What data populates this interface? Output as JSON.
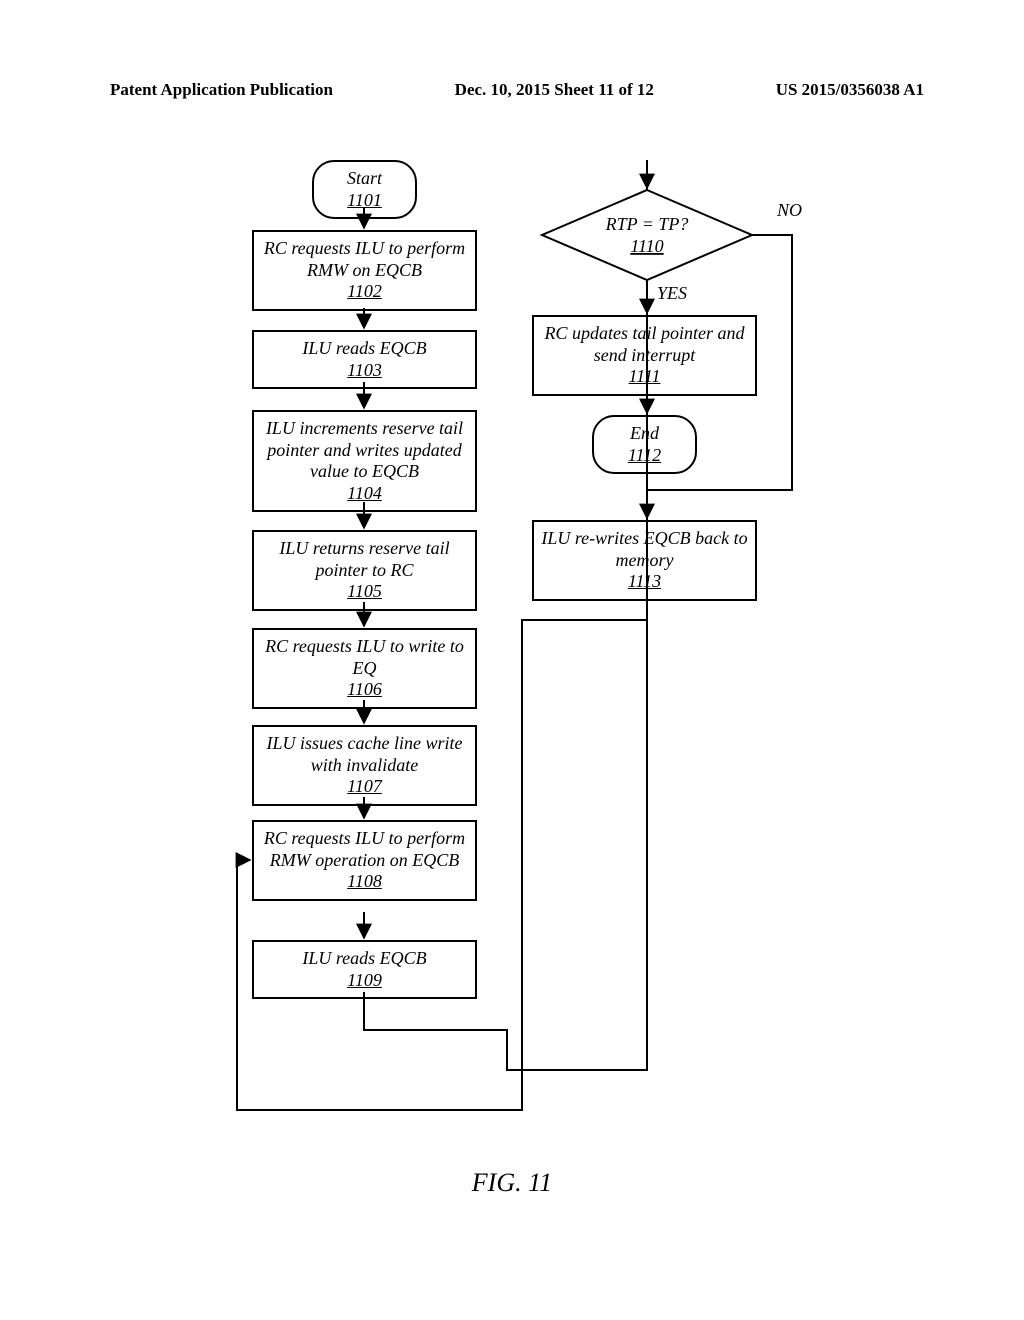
{
  "header": {
    "left": "Patent Application Publication",
    "center": "Dec. 10, 2015  Sheet 11 of 12",
    "right": "US 2015/0356038 A1"
  },
  "figure_label": "FIG. 11",
  "nodes": {
    "n1101": {
      "text": "Start",
      "ref": "1101"
    },
    "n1102": {
      "text": "RC requests ILU to perform RMW on EQCB",
      "ref": "1102"
    },
    "n1103": {
      "text": "ILU reads EQCB",
      "ref": "1103"
    },
    "n1104": {
      "text": "ILU increments reserve tail pointer and writes updated value to EQCB",
      "ref": "1104"
    },
    "n1105": {
      "text": "ILU returns reserve tail pointer to RC",
      "ref": "1105"
    },
    "n1106": {
      "text": "RC requests ILU to write to EQ",
      "ref": "1106"
    },
    "n1107": {
      "text": "ILU issues cache line write with invalidate",
      "ref": "1107"
    },
    "n1108": {
      "text": "RC requests ILU to perform RMW operation on EQCB",
      "ref": "1108"
    },
    "n1109": {
      "text": "ILU reads EQCB",
      "ref": "1109"
    },
    "n1110": {
      "text": "RTP = TP?",
      "ref": "1110"
    },
    "n1111": {
      "text": "RC updates tail pointer and send interrupt",
      "ref": "1111"
    },
    "n1112": {
      "text": "End",
      "ref": "1112"
    },
    "n1113": {
      "text": "ILU re-writes EQCB back to memory",
      "ref": "1113"
    }
  },
  "labels": {
    "yes": "YES",
    "no": "NO"
  }
}
